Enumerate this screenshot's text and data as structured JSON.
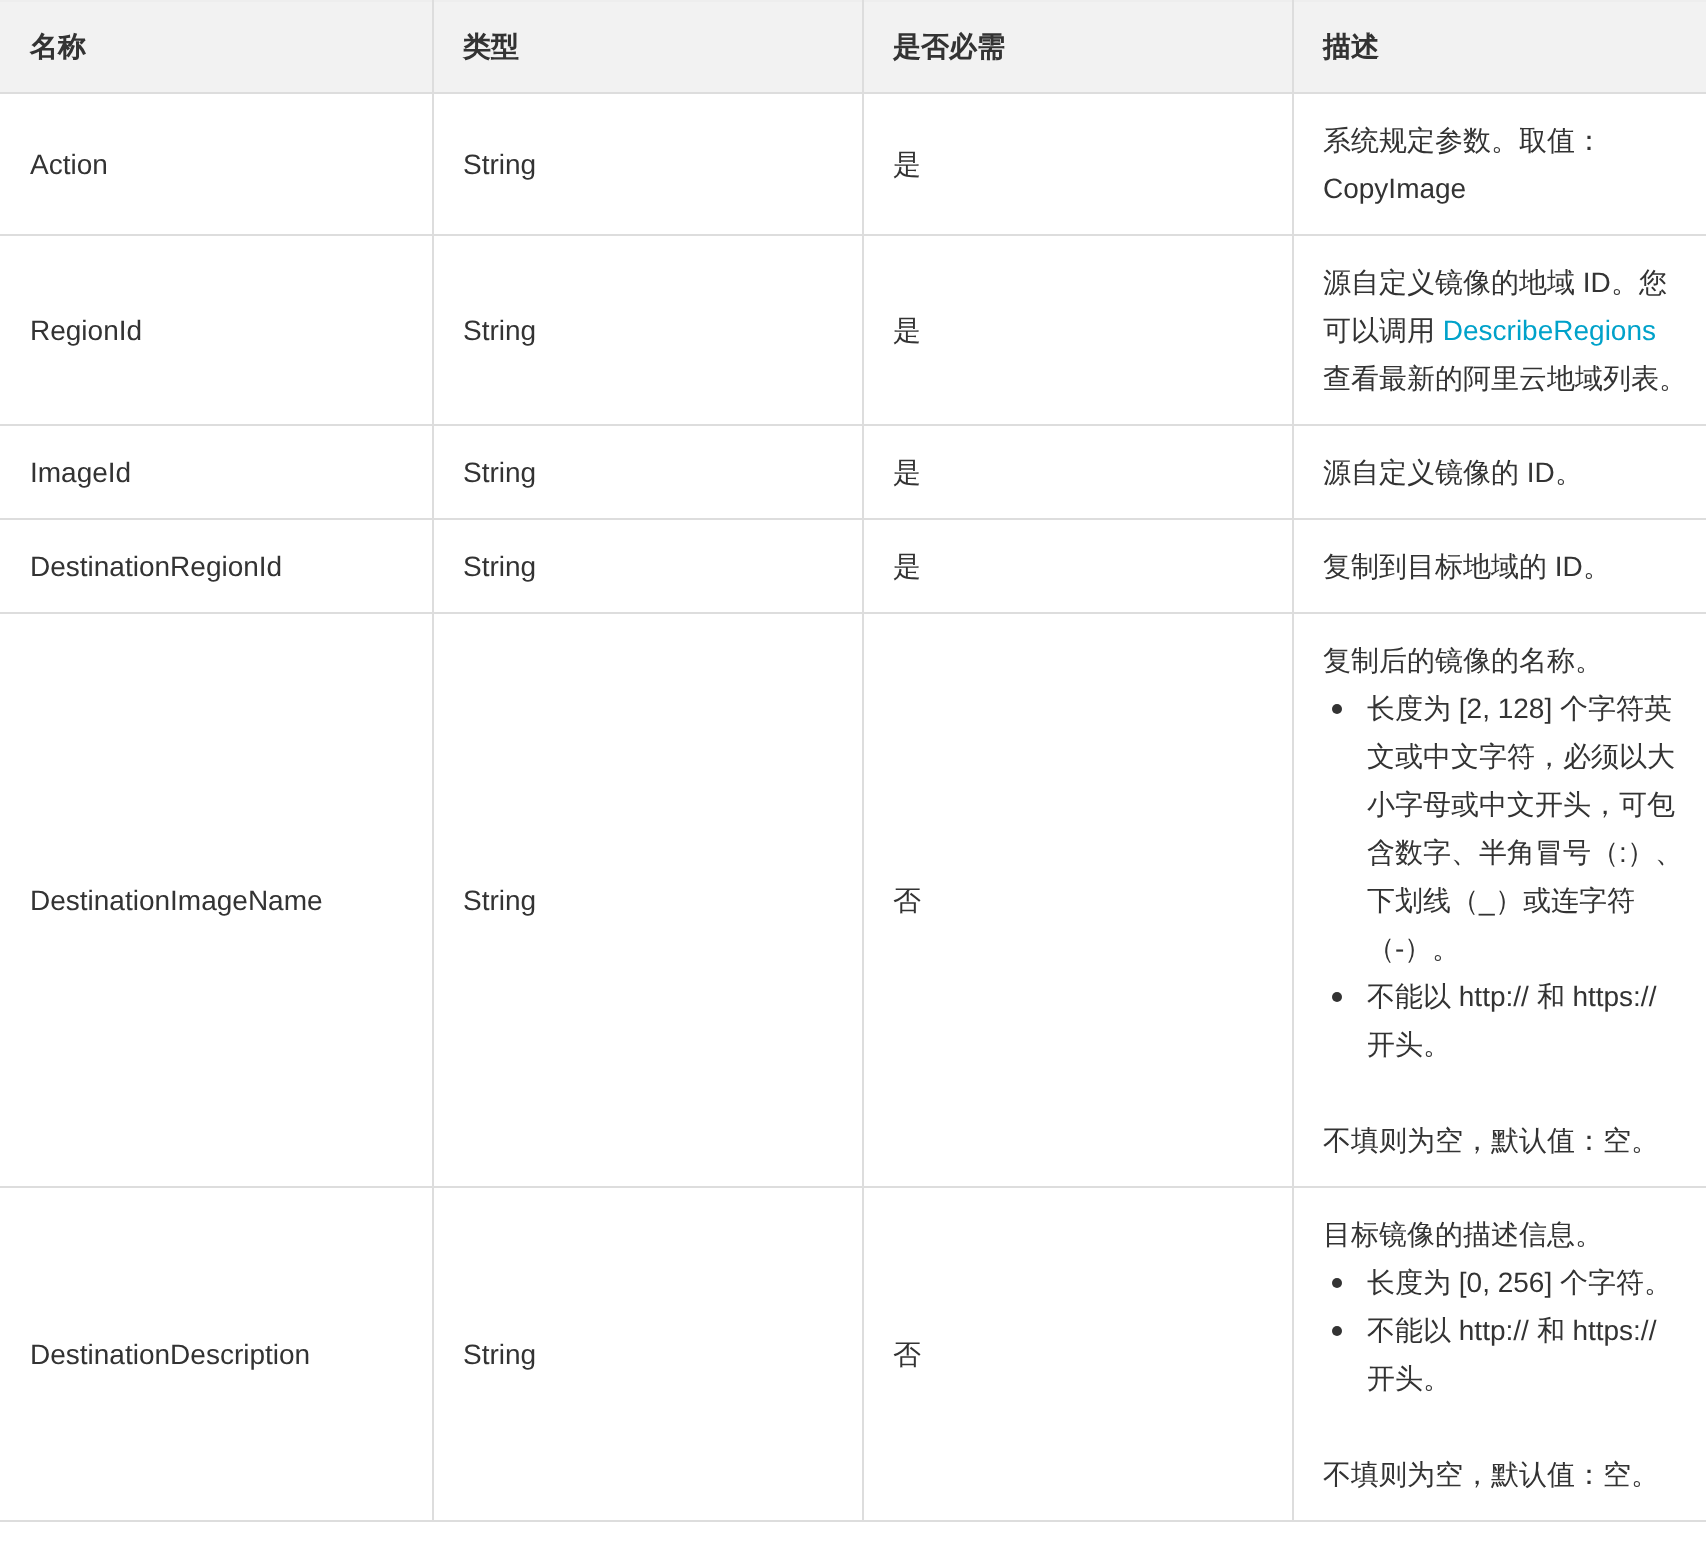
{
  "table": {
    "columns": [
      "名称",
      "类型",
      "是否必需",
      "描述"
    ],
    "rows": [
      {
        "name": "Action",
        "type": "String",
        "required": "是",
        "description": [
          {
            "kind": "text",
            "text": "系统规定参数。取值：CopyImage"
          }
        ]
      },
      {
        "name": "RegionId",
        "type": "String",
        "required": "是",
        "description": [
          {
            "kind": "linked",
            "before": "源自定义镜像的地域 ID。您可以调用 ",
            "link": "DescribeRegions",
            "after": " 查看最新的阿里云地域列表。"
          }
        ]
      },
      {
        "name": "ImageId",
        "type": "String",
        "required": "是",
        "description": [
          {
            "kind": "text",
            "text": "源自定义镜像的 ID。"
          }
        ]
      },
      {
        "name": "DestinationRegionId",
        "type": "String",
        "required": "是",
        "description": [
          {
            "kind": "text",
            "text": "复制到目标地域的 ID。"
          }
        ]
      },
      {
        "name": "DestinationImageName",
        "type": "String",
        "required": "否",
        "description": [
          {
            "kind": "text",
            "text": "复制后的镜像的名称。"
          },
          {
            "kind": "bullets",
            "items": [
              "长度为 [2, 128] 个字符英文或中文字符，必须以大小字母或中文开头，可包含数字、半角冒号（:）、下划线（_）或连字符（-）。",
              "不能以 http:// 和 https:// 开头。"
            ]
          },
          {
            "kind": "text",
            "text": "不填则为空，默认值：空。"
          }
        ]
      },
      {
        "name": "DestinationDescription",
        "type": "String",
        "required": "否",
        "description": [
          {
            "kind": "text",
            "text": "目标镜像的描述信息。"
          },
          {
            "kind": "bullets",
            "items": [
              "长度为 [0, 256] 个字符。",
              "不能以 http:// 和 https:// 开头。"
            ]
          },
          {
            "kind": "text",
            "text": "不填则为空，默认值：空。"
          }
        ]
      }
    ]
  }
}
